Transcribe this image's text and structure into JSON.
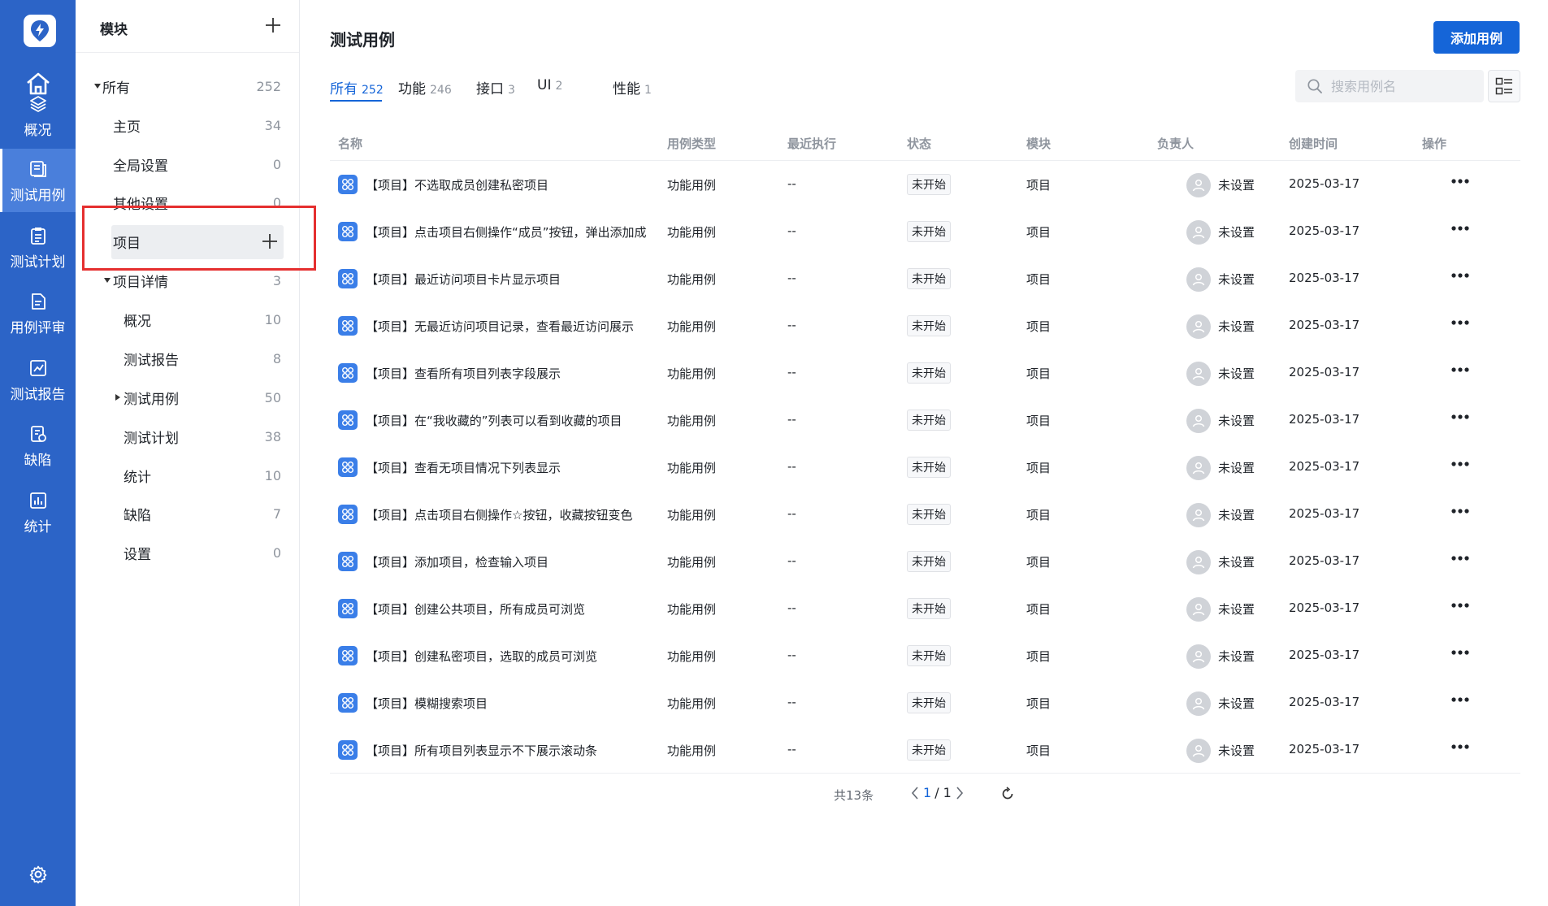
{
  "nav": {
    "items": [
      {
        "label": "概况",
        "icon": "layers-icon"
      },
      {
        "label": "测试用例",
        "icon": "case-icon"
      },
      {
        "label": "测试计划",
        "icon": "clipboard-icon"
      },
      {
        "label": "用例评审",
        "icon": "review-icon"
      },
      {
        "label": "测试报告",
        "icon": "report-icon"
      },
      {
        "label": "缺陷",
        "icon": "defect-icon"
      },
      {
        "label": "统计",
        "icon": "stats-icon"
      }
    ],
    "active_index": 1,
    "accent": "#2c64c7"
  },
  "tree": {
    "title": "模块",
    "items": [
      {
        "label": "所有",
        "count": "252"
      },
      {
        "label": "主页",
        "count": "34"
      },
      {
        "label": "全局设置",
        "count": "0"
      },
      {
        "label": "其他设置",
        "count": "0"
      },
      {
        "label": "项目",
        "count": ""
      },
      {
        "label": "项目详情",
        "count": "3"
      },
      {
        "label": "概况",
        "count": "10"
      },
      {
        "label": "测试报告",
        "count": "8"
      },
      {
        "label": "测试用例",
        "count": "50"
      },
      {
        "label": "测试计划",
        "count": "38"
      },
      {
        "label": "统计",
        "count": "10"
      },
      {
        "label": "缺陷",
        "count": "7"
      },
      {
        "label": "设置",
        "count": "0"
      }
    ]
  },
  "main": {
    "title": "测试用例",
    "add_button": "添加用例",
    "tabs": [
      {
        "label": "所有",
        "count": "252"
      },
      {
        "label": "功能",
        "count": "246"
      },
      {
        "label": "接口",
        "count": "3"
      },
      {
        "label": "UI",
        "count": "2"
      },
      {
        "label": "性能",
        "count": "1"
      }
    ],
    "search_placeholder": "搜索用例名"
  },
  "table": {
    "headers": [
      "名称",
      "用例类型",
      "最近执行",
      "状态",
      "模块",
      "负责人",
      "创建时间",
      "操作"
    ],
    "rows": [
      {
        "name": "【项目】不选取成员创建私密项目",
        "type": "功能用例",
        "last": "--",
        "status": "未开始",
        "module": "项目",
        "owner": "未设置",
        "created": "2025-03-17"
      },
      {
        "name": "【项目】点击项目右侧操作“成员”按钮，弹出添加成",
        "type": "功能用例",
        "last": "--",
        "status": "未开始",
        "module": "项目",
        "owner": "未设置",
        "created": "2025-03-17"
      },
      {
        "name": "【项目】最近访问项目卡片显示项目",
        "type": "功能用例",
        "last": "--",
        "status": "未开始",
        "module": "项目",
        "owner": "未设置",
        "created": "2025-03-17"
      },
      {
        "name": "【项目】无最近访问项目记录，查看最近访问展示",
        "type": "功能用例",
        "last": "--",
        "status": "未开始",
        "module": "项目",
        "owner": "未设置",
        "created": "2025-03-17"
      },
      {
        "name": "【项目】查看所有项目列表字段展示",
        "type": "功能用例",
        "last": "--",
        "status": "未开始",
        "module": "项目",
        "owner": "未设置",
        "created": "2025-03-17"
      },
      {
        "name": "【项目】在“我收藏的”列表可以看到收藏的项目",
        "type": "功能用例",
        "last": "--",
        "status": "未开始",
        "module": "项目",
        "owner": "未设置",
        "created": "2025-03-17"
      },
      {
        "name": "【项目】查看无项目情况下列表显示",
        "type": "功能用例",
        "last": "--",
        "status": "未开始",
        "module": "项目",
        "owner": "未设置",
        "created": "2025-03-17"
      },
      {
        "name": "【项目】点击项目右侧操作☆按钮，收藏按钮变色",
        "type": "功能用例",
        "last": "--",
        "status": "未开始",
        "module": "项目",
        "owner": "未设置",
        "created": "2025-03-17"
      },
      {
        "name": "【项目】添加项目，检查输入项目",
        "type": "功能用例",
        "last": "--",
        "status": "未开始",
        "module": "项目",
        "owner": "未设置",
        "created": "2025-03-17"
      },
      {
        "name": "【项目】创建公共项目，所有成员可浏览",
        "type": "功能用例",
        "last": "--",
        "status": "未开始",
        "module": "项目",
        "owner": "未设置",
        "created": "2025-03-17"
      },
      {
        "name": "【项目】创建私密项目，选取的成员可浏览",
        "type": "功能用例",
        "last": "--",
        "status": "未开始",
        "module": "项目",
        "owner": "未设置",
        "created": "2025-03-17"
      },
      {
        "name": "【项目】模糊搜索项目",
        "type": "功能用例",
        "last": "--",
        "status": "未开始",
        "module": "项目",
        "owner": "未设置",
        "created": "2025-03-17"
      },
      {
        "name": "【项目】所有项目列表显示不下展示滚动条",
        "type": "功能用例",
        "last": "--",
        "status": "未开始",
        "module": "项目",
        "owner": "未设置",
        "created": "2025-03-17"
      }
    ]
  },
  "pager": {
    "total": "共13条",
    "current": "1",
    "sep": "/ 1"
  }
}
